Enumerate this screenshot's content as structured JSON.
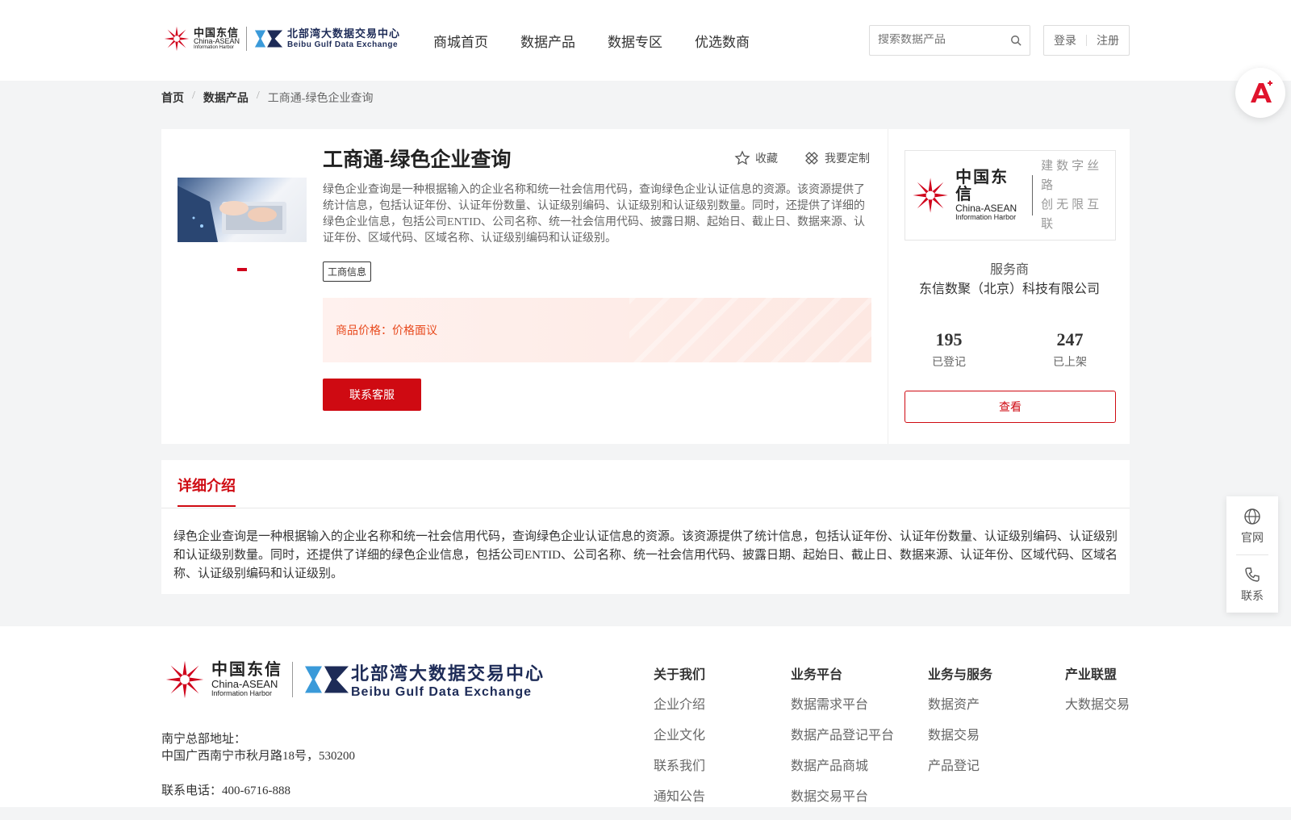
{
  "header": {
    "logo_cn": "中国东信",
    "logo_en1": "China-ASEAN",
    "logo_en2": "Information Harbor",
    "bb_cn": "北部湾大数据交易中心",
    "bb_en": "Beibu Gulf Data Exchange",
    "nav": [
      "商城首页",
      "数据产品",
      "数据专区",
      "优选数商"
    ],
    "search_placeholder": "搜索数据产品",
    "login": "登录",
    "register": "注册"
  },
  "breadcrumb": [
    "首页",
    "数据产品",
    "工商通-绿色企业查询"
  ],
  "product": {
    "title": "工商通-绿色企业查询",
    "favorite": "收藏",
    "customize": "我要定制",
    "description": "绿色企业查询是一种根据输入的企业名称和统一社会信用代码，查询绿色企业认证信息的资源。该资源提供了统计信息，包括认证年份、认证年份数量、认证级别编码、认证级别和认证级别数量。同时，还提供了详细的绿色企业信息，包括公司ENTID、公司名称、统一社会信用代码、披露日期、起始日、截止日、数据来源、认证年份、区域代码、区域名称、认证级别编码和认证级别。",
    "tag": "工商信息",
    "price_label": "商品价格：",
    "price_value": "价格面议",
    "contact_button": "联系客服"
  },
  "provider": {
    "logo_cn": "中国东信",
    "logo_en1": "China-ASEAN",
    "logo_en2": "Information Harbor",
    "slogan1": "建数字丝路",
    "slogan2": "创无限互联",
    "label": "服务商",
    "name": "东信数聚（北京）科技有限公司",
    "registered_count": "195",
    "registered_label": "已登记",
    "listed_count": "247",
    "listed_label": "已上架",
    "view_button": "查看"
  },
  "detail": {
    "tab": "详细介绍",
    "text": "绿色企业查询是一种根据输入的企业名称和统一社会信用代码，查询绿色企业认证信息的资源。该资源提供了统计信息，包括认证年份、认证年份数量、认证级别编码、认证级别和认证级别数量。同时，还提供了详细的绿色企业信息，包括公司ENTID、公司名称、统一社会信用代码、披露日期、起始日、截止日、数据来源、认证年份、区域代码、区域名称、认证级别编码和认证级别。"
  },
  "sidebar": {
    "website": "官网",
    "contact": "联系"
  },
  "footer": {
    "address_label": "南宁总部地址：",
    "address": "中国广西南宁市秋月路18号，530200",
    "phone": "联系电话：400-6716-888",
    "columns": [
      {
        "title": "关于我们",
        "items": [
          "企业介绍",
          "企业文化",
          "联系我们",
          "通知公告"
        ]
      },
      {
        "title": "业务平台",
        "items": [
          "数据需求平台",
          "数据产品登记平台",
          "数据产品商城",
          "数据交易平台"
        ]
      },
      {
        "title": "业务与服务",
        "items": [
          "数据资产",
          "数据交易",
          "产品登记"
        ]
      },
      {
        "title": "产业联盟",
        "items": [
          "大数据交易"
        ]
      }
    ]
  },
  "colors": {
    "brand_red": "#cf0a12",
    "navy": "#1d2b57",
    "price_orange": "#e8491d"
  },
  "icons": [
    "china-asean-logo-icon",
    "beibu-gulf-logo-icon",
    "search-icon",
    "star-icon",
    "customize-icon",
    "ai-assistant-icon",
    "globe-icon",
    "phone-icon"
  ]
}
